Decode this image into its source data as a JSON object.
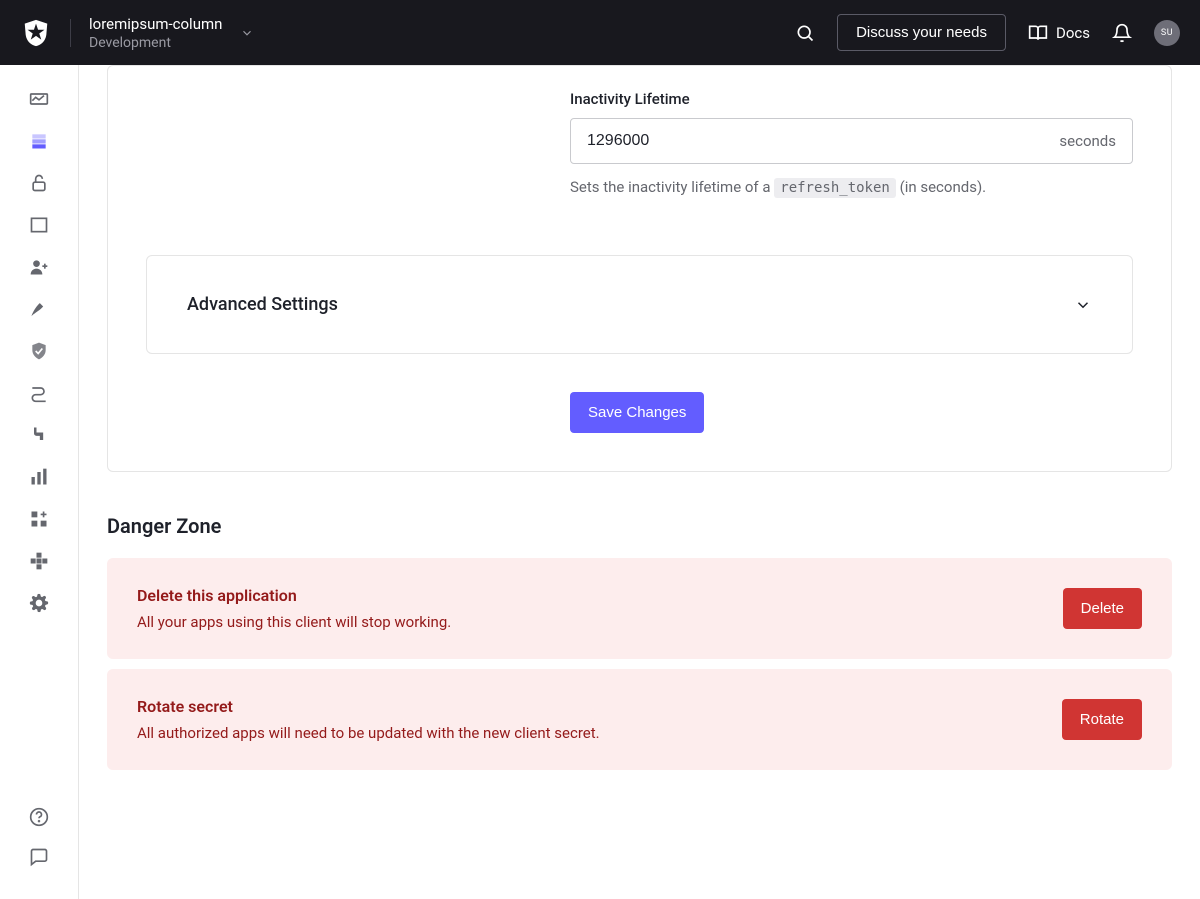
{
  "header": {
    "tenant_name": "loremipsum-column",
    "tenant_env": "Development",
    "discuss_button": "Discuss your needs",
    "docs_label": "Docs",
    "avatar_initials": "SU"
  },
  "form": {
    "inactivity_label": "Inactivity Lifetime",
    "inactivity_value": "1296000",
    "inactivity_unit": "seconds",
    "inactivity_help_pre": "Sets the inactivity lifetime of a ",
    "inactivity_help_code": "refresh_token",
    "inactivity_help_post": " (in seconds).",
    "advanced_label": "Advanced Settings",
    "save_label": "Save Changes"
  },
  "danger": {
    "heading": "Danger Zone",
    "items": [
      {
        "title": "Delete this application",
        "desc": "All your apps using this client will stop working.",
        "button": "Delete"
      },
      {
        "title": "Rotate secret",
        "desc": "All authorized apps will need to be updated with the new client secret.",
        "button": "Rotate"
      }
    ]
  }
}
